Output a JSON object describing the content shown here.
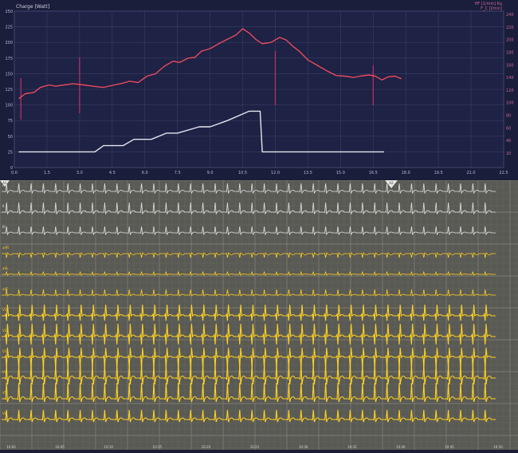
{
  "top_chart": {
    "left_axis_title": "Charge [Watt]",
    "right_axis_title_1": "HF [1/min] Kg",
    "right_axis_title_2": "F_C [l/min]",
    "left_ticks": [
      "250",
      "225",
      "200",
      "175",
      "150",
      "125",
      "100",
      "75",
      "50",
      "25",
      "0"
    ],
    "right_ticks": [
      "240",
      "220",
      "200",
      "180",
      "160",
      "140",
      "120",
      "100",
      "80",
      "60",
      "40",
      "20"
    ],
    "x_ticks": [
      "0.0",
      "1.5",
      "3.0",
      "4.5",
      "6.0",
      "7.5",
      "9.0",
      "10.5",
      "12.0",
      "13.5",
      "15.0",
      "16.5",
      "18.0",
      "19.5",
      "21.0",
      "22.5"
    ],
    "colors": {
      "heart_rate": "#e84a5f",
      "load": "#e6e6f0",
      "markers": "#c0306a",
      "grid": "#3a3f66"
    },
    "chart_data": {
      "type": "line",
      "xlim": [
        0,
        22.5
      ],
      "ylim_left": [
        0,
        250
      ],
      "ylim_right": [
        0,
        250
      ],
      "series": [
        {
          "name": "Charge [Watt]",
          "axis": "left",
          "x": [
            0.2,
            3.7,
            4.1,
            5.0,
            5.5,
            6.3,
            7.0,
            7.5,
            8.5,
            9.0,
            9.8,
            10.8,
            11.3,
            11.4,
            11.6,
            12.0,
            13.0,
            14.5,
            16.0,
            17.0
          ],
          "y": [
            25,
            25,
            35,
            35,
            45,
            45,
            55,
            55,
            65,
            65,
            75,
            90,
            90,
            25,
            25,
            25,
            25,
            25,
            25,
            25
          ]
        },
        {
          "name": "HF",
          "axis": "right",
          "x": [
            0.2,
            0.5,
            0.9,
            1.2,
            1.6,
            1.9,
            2.3,
            2.7,
            3.2,
            3.6,
            4.1,
            4.6,
            5.0,
            5.3,
            5.7,
            6.1,
            6.5,
            6.9,
            7.3,
            7.6,
            8.0,
            8.3,
            8.6,
            9.0,
            9.4,
            9.8,
            10.2,
            10.5,
            10.8,
            11.1,
            11.4,
            11.8,
            12.2,
            12.5,
            12.8,
            13.1,
            13.5,
            13.8,
            14.1,
            14.4,
            14.8,
            15.2,
            15.6,
            15.9,
            16.3,
            16.6,
            16.9,
            17.2,
            17.5,
            17.8
          ],
          "y": [
            110,
            118,
            120,
            128,
            132,
            130,
            132,
            134,
            132,
            130,
            128,
            132,
            135,
            138,
            136,
            146,
            150,
            162,
            170,
            168,
            175,
            176,
            186,
            190,
            198,
            205,
            212,
            222,
            215,
            205,
            198,
            200,
            208,
            204,
            194,
            186,
            172,
            166,
            160,
            154,
            147,
            146,
            144,
            146,
            148,
            146,
            140,
            145,
            146,
            142
          ]
        }
      ],
      "markers_x": [
        0.3,
        3.0,
        12.0,
        16.5
      ]
    }
  },
  "ecg_panel": {
    "top_labels": [
      "A1",
      "A2"
    ],
    "lead_labels": [
      "I",
      "II",
      "III",
      "aVR",
      "aVL",
      "aVF",
      "V1",
      "V2",
      "V3",
      "V4",
      "V5",
      "V6"
    ],
    "time_labels": [
      "10:00",
      "10:05",
      "10:10",
      "10:15",
      "10:20",
      "10:25",
      "10:30",
      "10:35",
      "10:40",
      "10:45",
      "10:50"
    ],
    "colors": {
      "limb": "#e3e3e3",
      "precordial": "#ffd21f",
      "grid_minor": "#6b6b64",
      "grid_major": "#858579",
      "background": "#5a5a55"
    }
  }
}
